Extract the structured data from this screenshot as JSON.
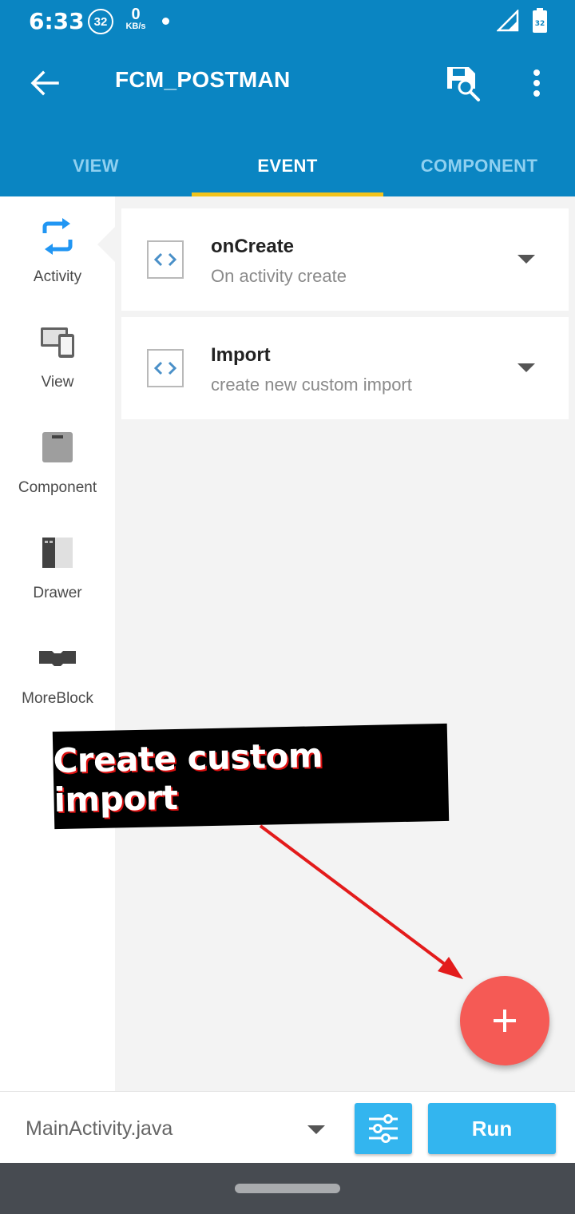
{
  "status_bar": {
    "time": "6:33",
    "notification_badge": "32",
    "data_speed_value": "0",
    "data_speed_unit": "KB/s",
    "battery_level": "32"
  },
  "app_bar": {
    "title": "FCM_POSTMAN",
    "back_icon": "arrow-left-icon",
    "save_icon": "save-icon",
    "more_icon": "more-vert-icon"
  },
  "tabs": [
    {
      "label": "VIEW",
      "active": false
    },
    {
      "label": "EVENT",
      "active": true
    },
    {
      "label": "COMPONENT",
      "active": false
    }
  ],
  "sidebar": {
    "items": [
      {
        "label": "Activity",
        "icon": "refresh-icon",
        "selected": true
      },
      {
        "label": "View",
        "icon": "devices-icon",
        "selected": false
      },
      {
        "label": "Component",
        "icon": "component-icon",
        "selected": false
      },
      {
        "label": "Drawer",
        "icon": "drawer-icon",
        "selected": false
      },
      {
        "label": "MoreBlock",
        "icon": "moreblock-icon",
        "selected": false
      }
    ]
  },
  "events": [
    {
      "title": "onCreate",
      "subtitle": "On activity create",
      "icon": "code-brackets-icon"
    },
    {
      "title": "Import",
      "subtitle": "create new custom import",
      "icon": "code-brackets-icon"
    }
  ],
  "annotation": {
    "text": "Create custom import",
    "arrow_color": "#e31b1b"
  },
  "fab": {
    "icon": "plus-icon",
    "color": "#f55a55"
  },
  "bottom_bar": {
    "file_name": "MainActivity.java",
    "settings_icon": "sliders-icon",
    "run_label": "Run"
  },
  "colors": {
    "primary": "#0a85c2",
    "tab_indicator": "#f2c31b",
    "accent_button": "#33b5ef"
  }
}
